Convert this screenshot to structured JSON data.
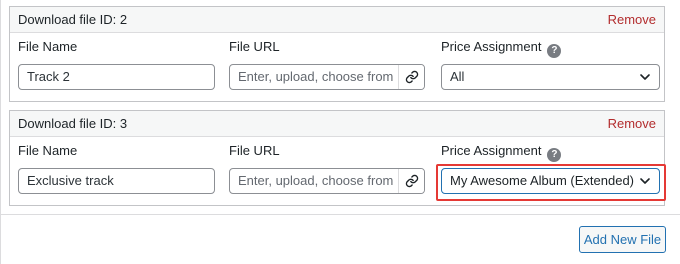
{
  "files": [
    {
      "header_title": "Download file ID: 2",
      "remove_label": "Remove",
      "file_name_label": "File Name",
      "file_url_label": "File URL",
      "price_label": "Price Assignment",
      "file_name_value": "Track 2",
      "file_url_placeholder": "Enter, upload, choose from M",
      "price_value": "All"
    },
    {
      "header_title": "Download file ID: 3",
      "remove_label": "Remove",
      "file_name_label": "File Name",
      "file_url_label": "File URL",
      "price_label": "Price Assignment",
      "file_name_value": "Exclusive track",
      "file_url_placeholder": "Enter, upload, choose from M",
      "price_value": "My Awesome Album (Extended)"
    }
  ],
  "help_icon_glyph": "?",
  "add_new_label": "Add New File",
  "colors": {
    "remove": "#b32d2e",
    "highlight": "#e53935",
    "accent": "#2271b1"
  }
}
